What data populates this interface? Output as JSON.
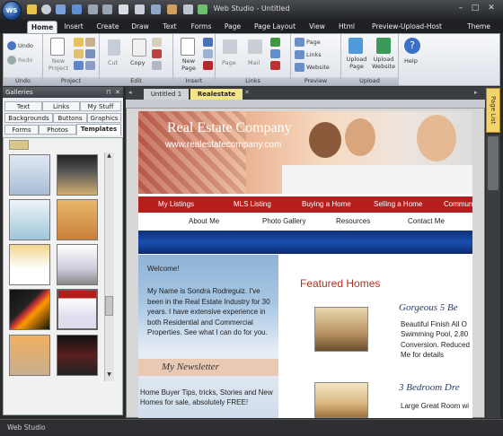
{
  "app": {
    "logo": "WS 5",
    "title": "Web Studio - Untitled"
  },
  "window_controls": {
    "minimize": "–",
    "maximize": "□",
    "close": "✕"
  },
  "ribbon_tabs": [
    "Home",
    "Insert",
    "Create",
    "Draw",
    "Text",
    "Forms",
    "Page",
    "Page Layout",
    "View",
    "Html",
    "Preview-Upload-Host"
  ],
  "active_ribbon_tab": "Home",
  "theme_menu": "Theme",
  "ribbon": {
    "undo": {
      "undo_label": "Undo",
      "redo_label": "Redo",
      "group": "Undo"
    },
    "project": {
      "new_label": "New\nProject",
      "group": "Project"
    },
    "edit": {
      "cut_label": "Cut",
      "copy_label": "Copy",
      "group": "Edit"
    },
    "insert": {
      "new_page_label": "New\nPage",
      "group": "Insert"
    },
    "links": {
      "page_label": "Page",
      "mail_label": "Mail",
      "group": "Links"
    },
    "preview": {
      "page_label": "Page",
      "links_label": "Links",
      "website_label": "Website",
      "group": "Preview"
    },
    "upload": {
      "upload_page_label": "Upload\nPage",
      "upload_website_label": "Upload\nWebsite",
      "group": "Upload"
    },
    "help": {
      "help_label": "Help"
    }
  },
  "galleries": {
    "title": "Galleries",
    "controls": {
      "pin": "⊓",
      "close": "✕"
    },
    "tab_rows": [
      [
        "Text",
        "Links",
        "My Stuff"
      ],
      [
        "Backgrounds",
        "Buttons",
        "Graphics"
      ],
      [
        "Forms",
        "Photos",
        "Templates"
      ]
    ],
    "active_tab": "Templates",
    "scroll_up": "▲",
    "scroll_down": "▼"
  },
  "document_tabs": [
    "Untitled 1",
    "Realestate"
  ],
  "active_document": "Realestate",
  "page_list_label": "Page List",
  "status_text": "Web Studio",
  "site": {
    "company": "Real Estate Company",
    "url": "www.realestatecompany.com",
    "nav_red": [
      "My Listings",
      "MLS Listing",
      "Buying a Home",
      "Selling a Home",
      "Commun"
    ],
    "nav_sub": [
      "About Me",
      "Photo Gallery",
      "Resources",
      "Contact Me"
    ],
    "welcome": "Welcome!",
    "intro": "My Name is Sondra Rodreguiz. I've been in the Real Estate Industry for 30 years. I have extensive experience in both Residential and Commercial Properties. See what I can do for you.",
    "newsletter_title": "My Newsletter",
    "newsletter_text": "Home Buyer Tips, tricks, Stories and New Homes for sale, absolutely FREE!",
    "featured_title": "Featured Homes",
    "listing1_title": "Gorgeous 5 Be",
    "listing1_desc": "Beautiful Finish All O Swimming Pool, 2,80 Conversion. Reduced Me for details",
    "listing2_title": "3 Bedroom Dre",
    "listing2_desc": "Large Great Room wi"
  },
  "colors": {
    "accent_red": "#b61d1d",
    "featured_red": "#b03020",
    "banner_blue": "#1a4fb0",
    "page_list_tab": "#f4d36b"
  }
}
